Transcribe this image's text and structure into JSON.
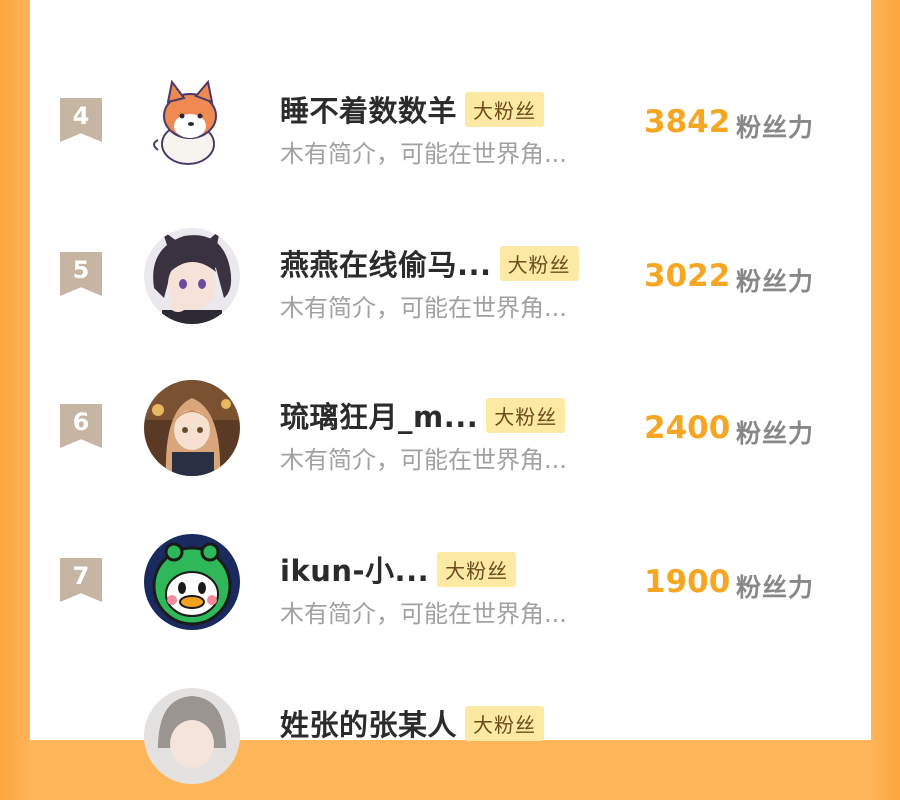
{
  "list": {
    "items": [
      {
        "rank": "4",
        "name": "睡不着数数羊",
        "badge": "大粉丝",
        "bio": "木有简介，可能在世界角...",
        "score": "3842",
        "score_label": "粉丝力",
        "avatar": "shiba-dog"
      },
      {
        "rank": "5",
        "name": "燕燕在线偷马...",
        "badge": "大粉丝",
        "bio": "木有简介，可能在世界角...",
        "score": "3022",
        "score_label": "粉丝力",
        "avatar": "anime-boy"
      },
      {
        "rank": "6",
        "name": "琉璃狂月_m...",
        "badge": "大粉丝",
        "bio": "木有简介，可能在世界角...",
        "score": "2400",
        "score_label": "粉丝力",
        "avatar": "anime-girl"
      },
      {
        "rank": "7",
        "name": "ikun-小...",
        "badge": "大粉丝",
        "bio": "木有简介，可能在世界角...",
        "score": "1900",
        "score_label": "粉丝力",
        "avatar": "green-hood-duck"
      },
      {
        "rank": "",
        "name": "姓张的张某人",
        "badge": "大粉丝",
        "bio": "",
        "score": "",
        "score_label": "",
        "avatar": "gray-hair"
      }
    ]
  }
}
